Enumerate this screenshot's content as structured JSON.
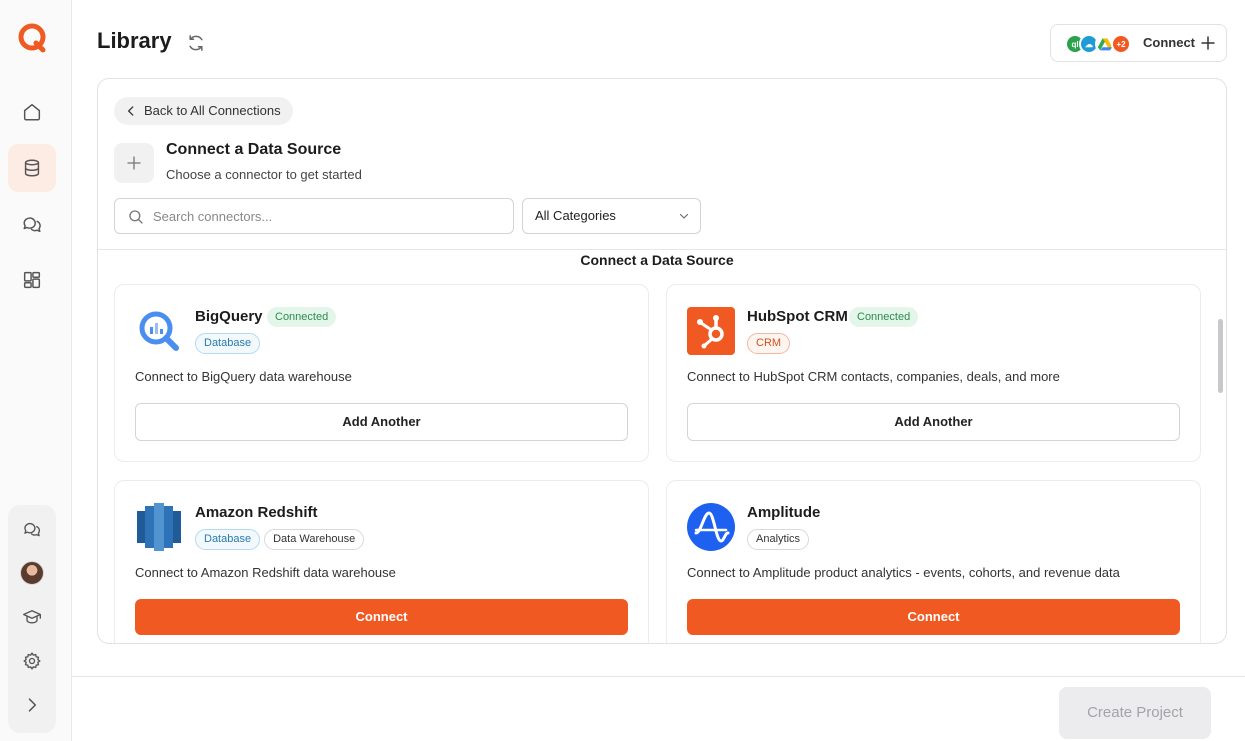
{
  "header": {
    "title": "Library",
    "connect_label": "Connect",
    "extra_count": "+2"
  },
  "panel": {
    "back_label": "Back to All Connections",
    "title": "Connect a Data Source",
    "subtitle": "Choose a connector to get started",
    "search_placeholder": "Search connectors...",
    "category_selected": "All Categories",
    "section_title": "Connect a Data Source"
  },
  "connectors": [
    {
      "name": "BigQuery",
      "status": "Connected",
      "tags": [
        "Database"
      ],
      "description": "Connect to BigQuery data warehouse",
      "action": "Add Another"
    },
    {
      "name": "HubSpot CRM",
      "status": "Connected",
      "tags": [
        "CRM"
      ],
      "description": "Connect to HubSpot CRM contacts, companies, deals, and more",
      "action": "Add Another"
    },
    {
      "name": "Amazon Redshift",
      "status": "",
      "tags": [
        "Database",
        "Data Warehouse"
      ],
      "description": "Connect to Amazon Redshift data warehouse",
      "action": "Connect"
    },
    {
      "name": "Amplitude",
      "status": "",
      "tags": [
        "Analytics"
      ],
      "description": "Connect to Amplitude product analytics - events, cohorts, and revenue data",
      "action": "Connect"
    }
  ],
  "footer": {
    "create_label": "Create Project"
  },
  "colors": {
    "accent": "#f05a22",
    "connected_bg": "#e4f6ea",
    "connected_text": "#2d8a4e",
    "disabled_bg": "#ececee"
  },
  "icons": {
    "sidebar": [
      "home-icon",
      "database-icon",
      "chat-icon",
      "dashboard-icon"
    ],
    "sidebar_bottom": [
      "support-chat-icon",
      "avatar",
      "learn-icon",
      "settings-icon",
      "expand-icon"
    ]
  }
}
